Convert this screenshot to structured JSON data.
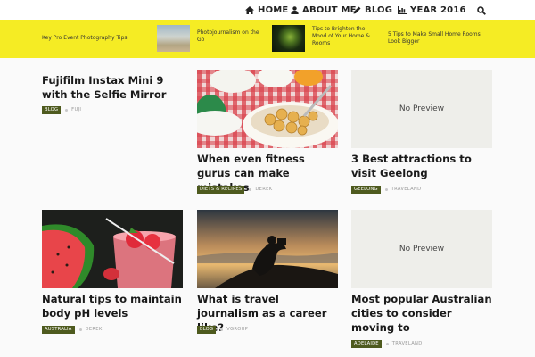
{
  "nav": {
    "items": [
      {
        "label": "HOME",
        "icon": "home-icon"
      },
      {
        "label": "ABOUT ME",
        "icon": "user-icon"
      },
      {
        "label": "BLOG",
        "icon": "pencil-icon"
      },
      {
        "label": "YEAR 2016",
        "icon": "bar-chart-icon"
      }
    ],
    "search_icon": "search-icon"
  },
  "strip": {
    "background": "#f5ec24",
    "items": [
      {
        "label": "Key Pro Event Photography Tips"
      },
      {
        "label": "Photojournalism on the Go"
      },
      {
        "label": "Tips to Brighten the Mood of Your Home & Rooms"
      },
      {
        "label": "5 Tips to Make Small Home Rooms Look Bigger"
      }
    ]
  },
  "posts": [
    {
      "title": "Fujifilm Instax Mini 9 with the Selfie Mirror",
      "category": "BLOG",
      "author": "FUJI"
    },
    {
      "title": "When even fitness gurus can make mistakes",
      "category": "DIETS & RECIPES",
      "author": "DEREK"
    },
    {
      "title": "3 Best attractions to visit Geelong",
      "category": "GEELONG",
      "author": "TRAVELAND",
      "image_placeholder": "No Preview"
    },
    {
      "title": "Natural tips to maintain body pH levels",
      "category": "AUSTRALIA",
      "author": "DEREK"
    },
    {
      "title": "What is travel journalism as a career like?",
      "category": "BLOG",
      "author": "VGROUP"
    },
    {
      "title": "Most popular Australian cities to consider moving to",
      "category": "ADELAIDE",
      "author": "TRAVELAND",
      "image_placeholder": "No Preview"
    }
  ],
  "colors": {
    "badge": "#4e5a1e",
    "accent_yellow": "#f5ec24"
  }
}
